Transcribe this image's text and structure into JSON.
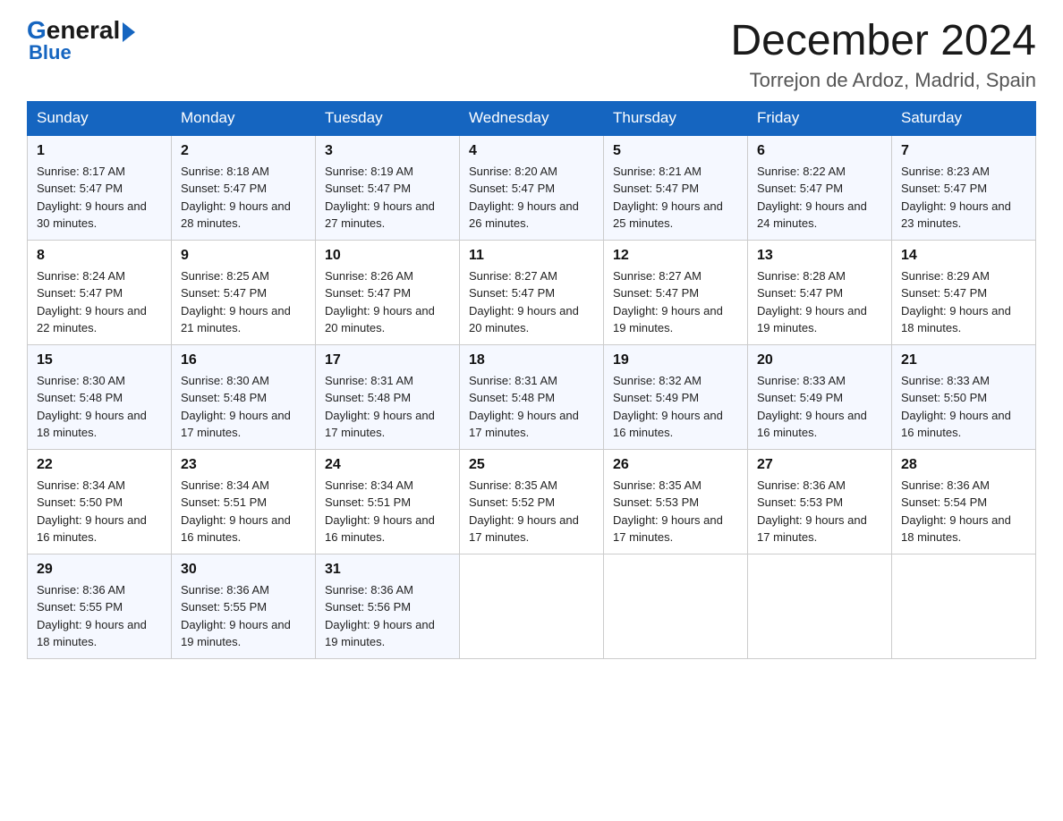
{
  "header": {
    "logo_general": "General",
    "logo_blue": "Blue",
    "month_year": "December 2024",
    "location": "Torrejon de Ardoz, Madrid, Spain"
  },
  "columns": [
    "Sunday",
    "Monday",
    "Tuesday",
    "Wednesday",
    "Thursday",
    "Friday",
    "Saturday"
  ],
  "weeks": [
    [
      {
        "day": "1",
        "sunrise": "Sunrise: 8:17 AM",
        "sunset": "Sunset: 5:47 PM",
        "daylight": "Daylight: 9 hours and 30 minutes."
      },
      {
        "day": "2",
        "sunrise": "Sunrise: 8:18 AM",
        "sunset": "Sunset: 5:47 PM",
        "daylight": "Daylight: 9 hours and 28 minutes."
      },
      {
        "day": "3",
        "sunrise": "Sunrise: 8:19 AM",
        "sunset": "Sunset: 5:47 PM",
        "daylight": "Daylight: 9 hours and 27 minutes."
      },
      {
        "day": "4",
        "sunrise": "Sunrise: 8:20 AM",
        "sunset": "Sunset: 5:47 PM",
        "daylight": "Daylight: 9 hours and 26 minutes."
      },
      {
        "day": "5",
        "sunrise": "Sunrise: 8:21 AM",
        "sunset": "Sunset: 5:47 PM",
        "daylight": "Daylight: 9 hours and 25 minutes."
      },
      {
        "day": "6",
        "sunrise": "Sunrise: 8:22 AM",
        "sunset": "Sunset: 5:47 PM",
        "daylight": "Daylight: 9 hours and 24 minutes."
      },
      {
        "day": "7",
        "sunrise": "Sunrise: 8:23 AM",
        "sunset": "Sunset: 5:47 PM",
        "daylight": "Daylight: 9 hours and 23 minutes."
      }
    ],
    [
      {
        "day": "8",
        "sunrise": "Sunrise: 8:24 AM",
        "sunset": "Sunset: 5:47 PM",
        "daylight": "Daylight: 9 hours and 22 minutes."
      },
      {
        "day": "9",
        "sunrise": "Sunrise: 8:25 AM",
        "sunset": "Sunset: 5:47 PM",
        "daylight": "Daylight: 9 hours and 21 minutes."
      },
      {
        "day": "10",
        "sunrise": "Sunrise: 8:26 AM",
        "sunset": "Sunset: 5:47 PM",
        "daylight": "Daylight: 9 hours and 20 minutes."
      },
      {
        "day": "11",
        "sunrise": "Sunrise: 8:27 AM",
        "sunset": "Sunset: 5:47 PM",
        "daylight": "Daylight: 9 hours and 20 minutes."
      },
      {
        "day": "12",
        "sunrise": "Sunrise: 8:27 AM",
        "sunset": "Sunset: 5:47 PM",
        "daylight": "Daylight: 9 hours and 19 minutes."
      },
      {
        "day": "13",
        "sunrise": "Sunrise: 8:28 AM",
        "sunset": "Sunset: 5:47 PM",
        "daylight": "Daylight: 9 hours and 19 minutes."
      },
      {
        "day": "14",
        "sunrise": "Sunrise: 8:29 AM",
        "sunset": "Sunset: 5:47 PM",
        "daylight": "Daylight: 9 hours and 18 minutes."
      }
    ],
    [
      {
        "day": "15",
        "sunrise": "Sunrise: 8:30 AM",
        "sunset": "Sunset: 5:48 PM",
        "daylight": "Daylight: 9 hours and 18 minutes."
      },
      {
        "day": "16",
        "sunrise": "Sunrise: 8:30 AM",
        "sunset": "Sunset: 5:48 PM",
        "daylight": "Daylight: 9 hours and 17 minutes."
      },
      {
        "day": "17",
        "sunrise": "Sunrise: 8:31 AM",
        "sunset": "Sunset: 5:48 PM",
        "daylight": "Daylight: 9 hours and 17 minutes."
      },
      {
        "day": "18",
        "sunrise": "Sunrise: 8:31 AM",
        "sunset": "Sunset: 5:48 PM",
        "daylight": "Daylight: 9 hours and 17 minutes."
      },
      {
        "day": "19",
        "sunrise": "Sunrise: 8:32 AM",
        "sunset": "Sunset: 5:49 PM",
        "daylight": "Daylight: 9 hours and 16 minutes."
      },
      {
        "day": "20",
        "sunrise": "Sunrise: 8:33 AM",
        "sunset": "Sunset: 5:49 PM",
        "daylight": "Daylight: 9 hours and 16 minutes."
      },
      {
        "day": "21",
        "sunrise": "Sunrise: 8:33 AM",
        "sunset": "Sunset: 5:50 PM",
        "daylight": "Daylight: 9 hours and 16 minutes."
      }
    ],
    [
      {
        "day": "22",
        "sunrise": "Sunrise: 8:34 AM",
        "sunset": "Sunset: 5:50 PM",
        "daylight": "Daylight: 9 hours and 16 minutes."
      },
      {
        "day": "23",
        "sunrise": "Sunrise: 8:34 AM",
        "sunset": "Sunset: 5:51 PM",
        "daylight": "Daylight: 9 hours and 16 minutes."
      },
      {
        "day": "24",
        "sunrise": "Sunrise: 8:34 AM",
        "sunset": "Sunset: 5:51 PM",
        "daylight": "Daylight: 9 hours and 16 minutes."
      },
      {
        "day": "25",
        "sunrise": "Sunrise: 8:35 AM",
        "sunset": "Sunset: 5:52 PM",
        "daylight": "Daylight: 9 hours and 17 minutes."
      },
      {
        "day": "26",
        "sunrise": "Sunrise: 8:35 AM",
        "sunset": "Sunset: 5:53 PM",
        "daylight": "Daylight: 9 hours and 17 minutes."
      },
      {
        "day": "27",
        "sunrise": "Sunrise: 8:36 AM",
        "sunset": "Sunset: 5:53 PM",
        "daylight": "Daylight: 9 hours and 17 minutes."
      },
      {
        "day": "28",
        "sunrise": "Sunrise: 8:36 AM",
        "sunset": "Sunset: 5:54 PM",
        "daylight": "Daylight: 9 hours and 18 minutes."
      }
    ],
    [
      {
        "day": "29",
        "sunrise": "Sunrise: 8:36 AM",
        "sunset": "Sunset: 5:55 PM",
        "daylight": "Daylight: 9 hours and 18 minutes."
      },
      {
        "day": "30",
        "sunrise": "Sunrise: 8:36 AM",
        "sunset": "Sunset: 5:55 PM",
        "daylight": "Daylight: 9 hours and 19 minutes."
      },
      {
        "day": "31",
        "sunrise": "Sunrise: 8:36 AM",
        "sunset": "Sunset: 5:56 PM",
        "daylight": "Daylight: 9 hours and 19 minutes."
      },
      null,
      null,
      null,
      null
    ]
  ]
}
